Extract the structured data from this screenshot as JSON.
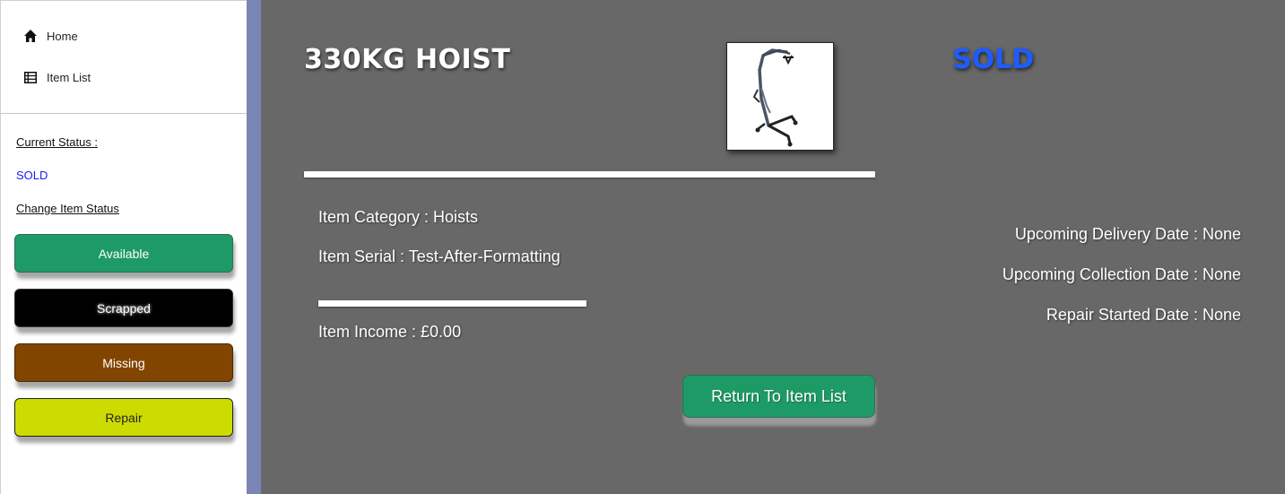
{
  "nav": {
    "items": [
      {
        "label": "Home",
        "icon": "home-icon"
      },
      {
        "label": "Item List",
        "icon": "table-list-icon"
      }
    ]
  },
  "status_panel": {
    "current_status_label": "Current Status :",
    "current_status_value": "SOLD",
    "change_status_label": "Change Item Status",
    "buttons": [
      {
        "label": "Available",
        "color": "#1e9a66"
      },
      {
        "label": "Scrapped",
        "color": "#000000"
      },
      {
        "label": "Missing",
        "color": "#824500"
      },
      {
        "label": "Repair",
        "color": "#cddc00"
      }
    ]
  },
  "item": {
    "title": "330KG HOIST",
    "status": "SOLD",
    "category": "Item Category : Hoists",
    "serial": "Item Serial : Test-After-Formatting",
    "income": "Item Income : £0.00",
    "image_icon": "hoist-image"
  },
  "dates": {
    "delivery": "Upcoming Delivery Date : None",
    "collection": "Upcoming Collection Date : None",
    "repair": "Repair Started Date : None"
  },
  "actions": {
    "return_label": "Return To Item List"
  },
  "colors": {
    "sold": "#1e5cff",
    "main_bg": "#686868",
    "strip": "#7a86b4"
  }
}
